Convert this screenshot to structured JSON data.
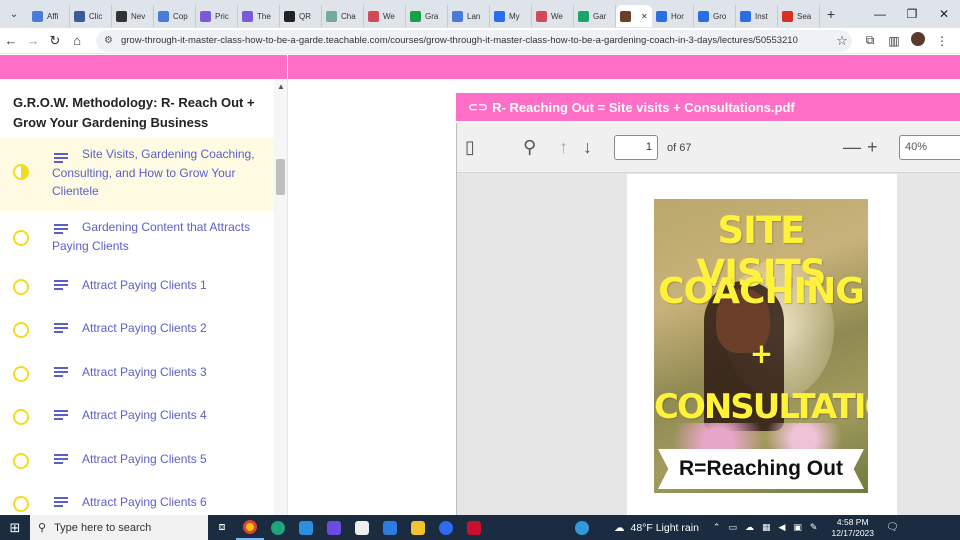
{
  "browser": {
    "tabs": [
      {
        "label": "Affi",
        "icon": "docs-icon",
        "color": "#4a7bd8"
      },
      {
        "label": "Clic",
        "icon": "screen-icon",
        "color": "#3a5a9a"
      },
      {
        "label": "Nev",
        "icon": "shield-icon",
        "color": "#333333"
      },
      {
        "label": "Cop",
        "icon": "docs-icon",
        "color": "#4a7bd8"
      },
      {
        "label": "Pric",
        "icon": "arrow-icon",
        "color": "#7a5ad8"
      },
      {
        "label": "The",
        "icon": "arrow-icon",
        "color": "#7a5ad8"
      },
      {
        "label": "QR",
        "icon": "github-icon",
        "color": "#222222"
      },
      {
        "label": "Cha",
        "icon": "chat-icon",
        "color": "#74aa9c"
      },
      {
        "label": "We",
        "icon": "globe-icon",
        "color": "#d04a5a"
      },
      {
        "label": "Gra",
        "icon": "grammarly-icon",
        "color": "#15a04a"
      },
      {
        "label": "Lan",
        "icon": "docs-icon",
        "color": "#4a7bd8"
      },
      {
        "label": "My",
        "icon": "zoom-icon",
        "color": "#2d6cf0"
      },
      {
        "label": "We",
        "icon": "globe-icon",
        "color": "#d04a5a"
      },
      {
        "label": "Gar",
        "icon": "teachable-icon",
        "color": "#1aa56a"
      },
      {
        "label": "",
        "icon": "page-icon",
        "color": "#6b3f2a",
        "active": true
      },
      {
        "label": "Hor",
        "icon": "teachable-icon",
        "color": "#2a6fe0"
      },
      {
        "label": "Gro",
        "icon": "teachable-icon",
        "color": "#2a6fe0"
      },
      {
        "label": "Inst",
        "icon": "teachable-icon",
        "color": "#2a6fe0"
      },
      {
        "label": "Sea",
        "icon": "gmail-icon",
        "color": "#d93025"
      }
    ],
    "url": "grow-through-it-master-class-how-to-be-a-garde.teachable.com/courses/grow-through-it-master-class-how-to-be-a-gardening-coach-in-3-days/lectures/50553210"
  },
  "sidebar": {
    "section_title": "G.R.O.W. Methodology: R- Reach Out + Grow Your Gardening Business",
    "lectures": [
      {
        "title": "Site Visits, Gardening Coaching, Consulting, and How to Grow Your Clientele",
        "active": true
      },
      {
        "title": "Gardening Content that Attracts Paying Clients"
      },
      {
        "title": "Attract Paying Clients 1"
      },
      {
        "title": "Attract Paying Clients 2"
      },
      {
        "title": "Attract Paying Clients 3"
      },
      {
        "title": "Attract Paying Clients 4"
      },
      {
        "title": "Attract Paying Clients 5"
      },
      {
        "title": "Attract Paying Clients 6"
      }
    ]
  },
  "attachment": {
    "title": "R- Reaching Out = Site visits + Consultations.pdf"
  },
  "pdf_viewer": {
    "current_page": "1",
    "page_count": "of 67",
    "zoom": "40%",
    "cover": {
      "line1": "SITE VISITS",
      "line2": "COACHING",
      "plus": "+",
      "line3": "CONSULTATIONS",
      "ribbon": "R=Reaching Out"
    }
  },
  "taskbar": {
    "search_placeholder": "Type here to search",
    "weather": "48°F  Light rain",
    "time": "4:58 PM",
    "date": "12/17/2023"
  }
}
